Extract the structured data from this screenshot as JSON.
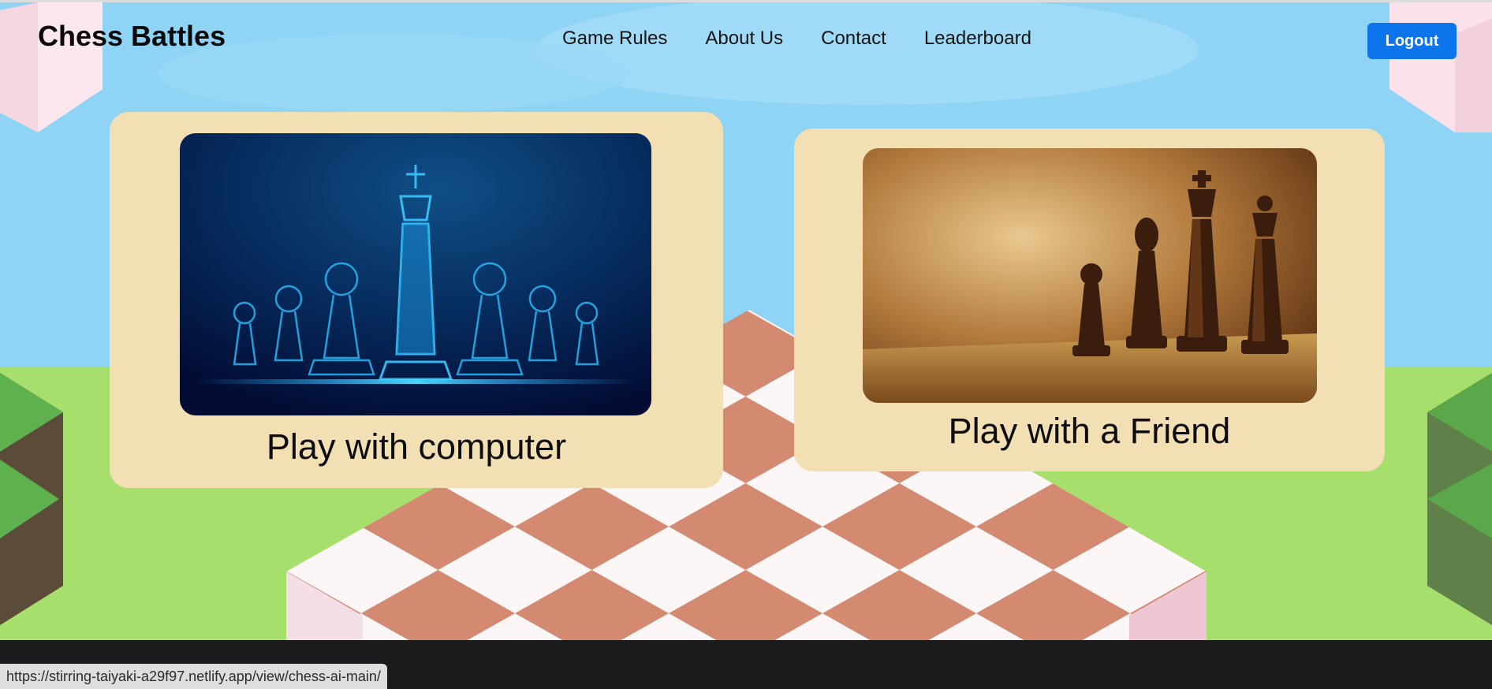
{
  "header": {
    "brand": "Chess Battles",
    "nav": [
      "Game Rules",
      "About Us",
      "Contact",
      "Leaderboard"
    ],
    "logout_label": "Logout"
  },
  "cards": [
    {
      "title": "Play with computer",
      "image": "glowing-blue-chess-king-and-pawns"
    },
    {
      "title": "Play with a Friend",
      "image": "wooden-chess-pieces-on-board"
    }
  ],
  "status_bar": {
    "url": "https://stirring-taiyaki-a29f97.netlify.app/view/chess-ai-main/"
  },
  "colors": {
    "sky": "#8fd3f5",
    "grass": "#a6df6c",
    "card": "#f3dfb4",
    "board_dark": "#d48a70",
    "board_light": "#fdf6f7",
    "logout": "#0d74ec"
  }
}
